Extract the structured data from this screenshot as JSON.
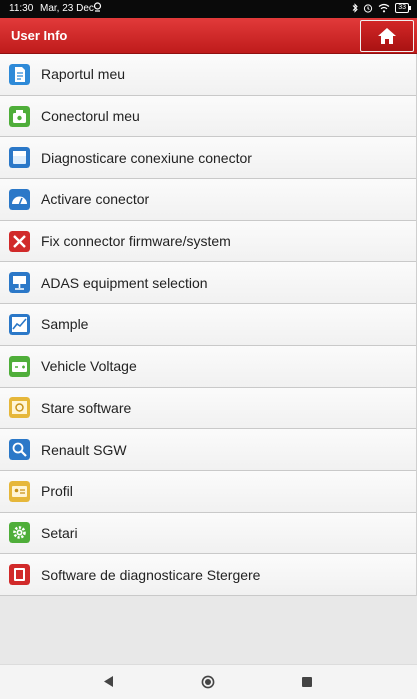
{
  "status_bar": {
    "time": "11:30",
    "date": "Mar, 23 Dec",
    "battery": "33"
  },
  "header": {
    "title": "User Info",
    "home_icon": "home-icon"
  },
  "menu": {
    "items": [
      {
        "label": "Raportul meu",
        "icon": "report-icon"
      },
      {
        "label": "Conectorul meu",
        "icon": "connector-icon"
      },
      {
        "label": "Diagnosticare conexiune conector",
        "icon": "connection-diagnostic-icon"
      },
      {
        "label": "Activare conector",
        "icon": "activate-icon"
      },
      {
        "label": "Fix connector firmware/system",
        "icon": "tools-icon"
      },
      {
        "label": "ADAS equipment selection",
        "icon": "adas-icon"
      },
      {
        "label": "Sample",
        "icon": "sample-chart-icon"
      },
      {
        "label": "Vehicle Voltage",
        "icon": "battery-icon"
      },
      {
        "label": "Stare software",
        "icon": "software-status-icon"
      },
      {
        "label": "Renault SGW",
        "icon": "sgw-search-icon"
      },
      {
        "label": "Profil",
        "icon": "profile-card-icon"
      },
      {
        "label": "Setari",
        "icon": "settings-gear-icon"
      },
      {
        "label": "Software de diagnosticare Stergere",
        "icon": "delete-software-icon"
      }
    ]
  },
  "colors": {
    "header_red": "#d02626",
    "blue": "#2b78c8",
    "green": "#4fae3a",
    "yellow": "#e6b73a",
    "red": "#d12a2a"
  }
}
